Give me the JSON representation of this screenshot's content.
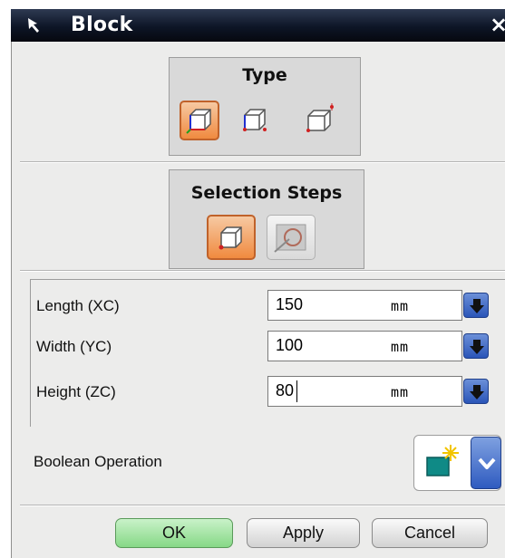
{
  "window": {
    "title": "Block",
    "close_glyph": "×"
  },
  "type_group": {
    "title": "Type",
    "options": [
      {
        "icon": "block-origin-edge-lengths-icon",
        "selected": true
      },
      {
        "icon": "block-two-points-height-icon",
        "selected": false
      },
      {
        "icon": "block-two-diagonal-points-icon",
        "selected": false
      }
    ]
  },
  "selection_steps": {
    "title": "Selection Steps",
    "steps": [
      {
        "icon": "origin-point-step-icon",
        "active": true
      },
      {
        "icon": "point-constructor-step-icon",
        "active": false,
        "disabled": true
      }
    ]
  },
  "parameters": [
    {
      "label": "Length (XC)",
      "value": "150",
      "unit": "mm"
    },
    {
      "label": "Width (YC)",
      "value": "100",
      "unit": "mm"
    },
    {
      "label": "Height (ZC)",
      "value": "80",
      "unit": "mm"
    }
  ],
  "boolean": {
    "label": "Boolean Operation",
    "icon": "boolean-create-icon"
  },
  "buttons": {
    "ok": "OK",
    "apply": "Apply",
    "cancel": "Cancel"
  },
  "colors": {
    "title_bar": "#0d1526",
    "active_orange": "#f08a3f",
    "ok_green": "#86d886",
    "dropdown_blue": "#2a55b8"
  }
}
